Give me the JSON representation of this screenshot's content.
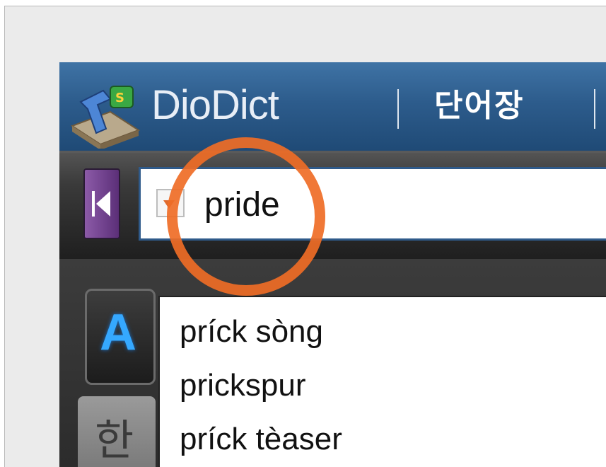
{
  "header": {
    "brand": "DioDict",
    "nav_item": "단어장"
  },
  "search": {
    "query": "pride"
  },
  "tabs": {
    "english": "A",
    "korean": "한"
  },
  "suggestions": [
    "príck sòng",
    "prickspur",
    "príck tèaser"
  ],
  "colors": {
    "header_blue": "#2d5c8c",
    "highlight_ring": "#ef6c26",
    "back_button_purple": "#6b3a8a",
    "tab_a_blue": "#35a8ff"
  }
}
